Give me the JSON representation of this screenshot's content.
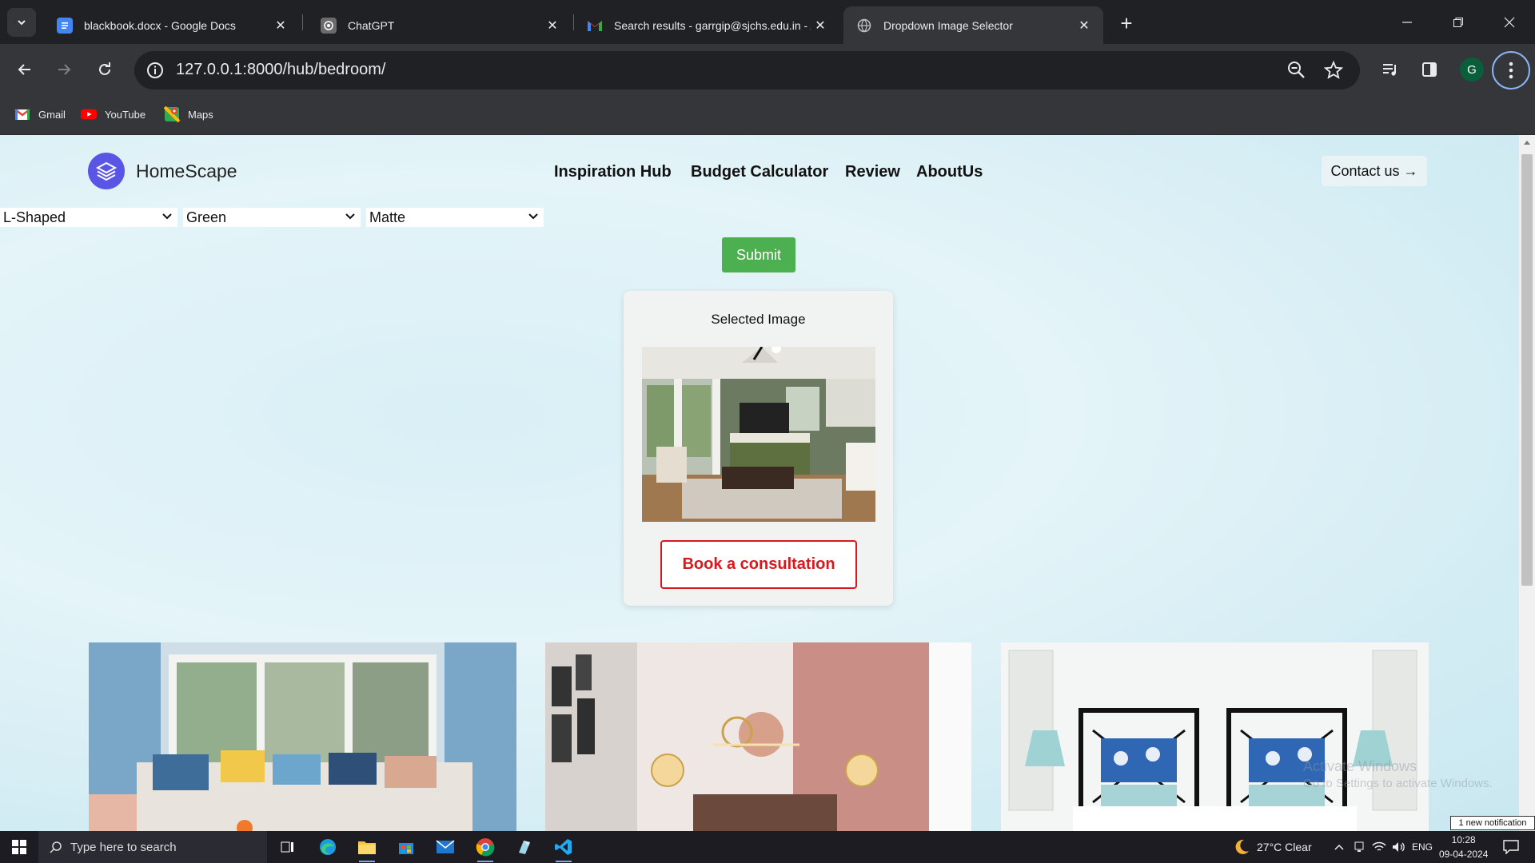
{
  "browser": {
    "tabs": [
      {
        "title": "blackbook.docx - Google Docs",
        "icon": "google-docs-icon"
      },
      {
        "title": "ChatGPT",
        "icon": "chatgpt-icon"
      },
      {
        "title": "Search results - garrgip@sjchs.edu.in - Alc",
        "icon": "gmail-icon"
      },
      {
        "title": "Dropdown Image Selector",
        "icon": "globe-icon",
        "active": true
      }
    ],
    "url": "127.0.0.1:8000/hub/bedroom/",
    "profile_initial": "G",
    "bookmarks": [
      {
        "label": "Gmail",
        "icon": "gmail-icon"
      },
      {
        "label": "YouTube",
        "icon": "youtube-icon"
      },
      {
        "label": "Maps",
        "icon": "maps-icon"
      }
    ]
  },
  "site": {
    "brand": "HomeScape",
    "nav": [
      "Inspiration Hub",
      "Budget Calculator",
      "Review",
      "AboutUs"
    ],
    "contact_label": "Contact us →",
    "selects": [
      {
        "value": "L-Shaped"
      },
      {
        "value": "Green"
      },
      {
        "value": "Matte"
      }
    ],
    "submit_label": "Submit",
    "card": {
      "heading": "Selected Image",
      "button_label": "Book a consultation"
    }
  },
  "overlay": {
    "watermark_line1": "Activate Windows",
    "watermark_line2": "Go to Settings to activate Windows.",
    "notification": "1 new notification"
  },
  "taskbar": {
    "search_placeholder": "Type here to search",
    "weather": "27°C  Clear",
    "language": "ENG",
    "time": "10:28",
    "date": "09-04-2024"
  },
  "colors": {
    "accent_green": "#4caf50",
    "brand_purple": "#5b55e6",
    "book_red": "#d9181e"
  }
}
